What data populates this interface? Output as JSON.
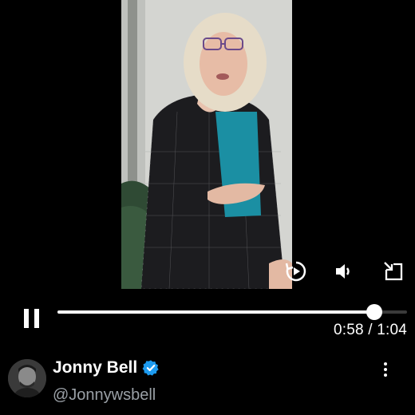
{
  "player": {
    "current_time": "0:58",
    "duration": "1:04",
    "separator": " / ",
    "progress_fraction": 0.906
  },
  "overlay_icons": [
    "replay-icon",
    "volume-icon",
    "exit-fullscreen-icon"
  ],
  "author": {
    "display_name": "Jonny Bell",
    "handle": "@Jonnywsbell",
    "verified_color": "#1d9bf0"
  },
  "colors": {
    "background": "#000000",
    "handle": "#9aa0a6",
    "track": "#3a3a3a",
    "accent": "#ffffff"
  }
}
